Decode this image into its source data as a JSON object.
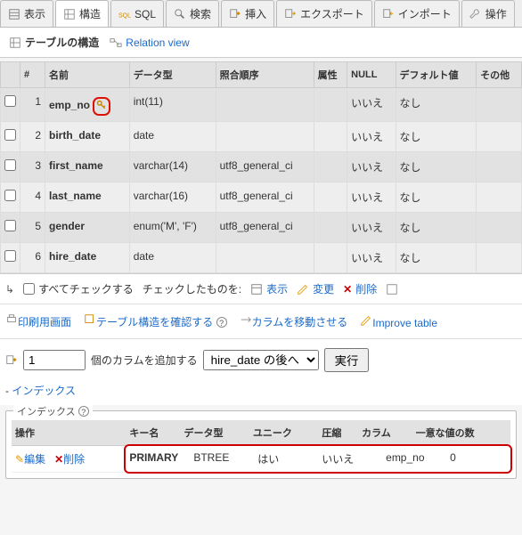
{
  "tabs": [
    {
      "label": "表示"
    },
    {
      "label": "構造"
    },
    {
      "label": "SQL"
    },
    {
      "label": "検索"
    },
    {
      "label": "挿入"
    },
    {
      "label": "エクスポート"
    },
    {
      "label": "インポート"
    },
    {
      "label": "操作"
    }
  ],
  "subtabs": {
    "structure": "テーブルの構造",
    "relation": "Relation view"
  },
  "headers": {
    "num": "#",
    "name": "名前",
    "type": "データ型",
    "collation": "照合順序",
    "attr": "属性",
    "null": "NULL",
    "default": "デフォルト値",
    "extra": "その他"
  },
  "rows": [
    {
      "num": "1",
      "name": "emp_no",
      "type": "int(11)",
      "collation": "",
      "attr": "",
      "null": "いいえ",
      "default": "なし",
      "pk": true
    },
    {
      "num": "2",
      "name": "birth_date",
      "type": "date",
      "collation": "",
      "attr": "",
      "null": "いいえ",
      "default": "なし",
      "pk": false
    },
    {
      "num": "3",
      "name": "first_name",
      "type": "varchar(14)",
      "collation": "utf8_general_ci",
      "attr": "",
      "null": "いいえ",
      "default": "なし",
      "pk": false
    },
    {
      "num": "4",
      "name": "last_name",
      "type": "varchar(16)",
      "collation": "utf8_general_ci",
      "attr": "",
      "null": "いいえ",
      "default": "なし",
      "pk": false
    },
    {
      "num": "5",
      "name": "gender",
      "type": "enum('M', 'F')",
      "collation": "utf8_general_ci",
      "attr": "",
      "null": "いいえ",
      "default": "なし",
      "pk": false
    },
    {
      "num": "6",
      "name": "hire_date",
      "type": "date",
      "collation": "",
      "attr": "",
      "null": "いいえ",
      "default": "なし",
      "pk": false
    }
  ],
  "toolbar": {
    "checkall": "すべてチェックする",
    "withsel": "チェックしたものを:",
    "browse": "表示",
    "change": "変更",
    "drop": "削除"
  },
  "toolbar2": {
    "print": "印刷用画面",
    "propose": "テーブル構造を確認する",
    "move": "カラムを移動させる",
    "improve": "Improve table"
  },
  "addcol": {
    "count": "1",
    "mid": "個のカラムを追加する",
    "after": "hire_date の後へ",
    "go": "実行"
  },
  "indexlink": "インデックス",
  "indexes": {
    "legend": "インデックス",
    "headers": {
      "action": "操作",
      "keyname": "キー名",
      "type": "データ型",
      "unique": "ユニーク",
      "packed": "圧縮",
      "column": "カラム",
      "cardinality": "一意な値の数"
    },
    "row": {
      "edit": "編集",
      "drop": "削除",
      "keyname": "PRIMARY",
      "type": "BTREE",
      "unique": "はい",
      "packed": "いいえ",
      "column": "emp_no",
      "cardinality": "0"
    }
  }
}
